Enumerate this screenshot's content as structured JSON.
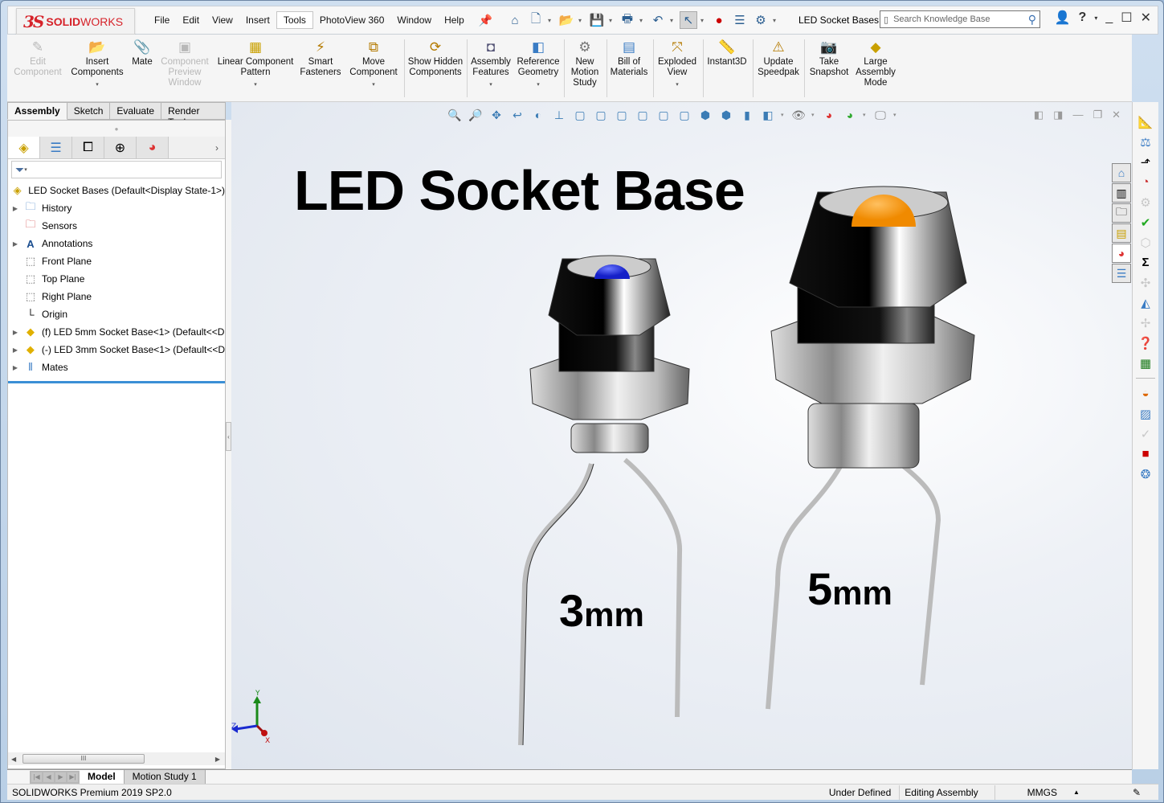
{
  "app": {
    "brand_prefix": "3S",
    "brand_bold": "SOLID",
    "brand_light": "WORKS",
    "document_title": "LED Socket Bases",
    "accent_color": "#d6232a"
  },
  "menu": [
    "File",
    "Edit",
    "View",
    "Insert",
    "Tools",
    "PhotoView 360",
    "Window",
    "Help"
  ],
  "menu_active": "Tools",
  "search": {
    "placeholder": "Search Knowledge Base"
  },
  "ribbon": [
    {
      "label": "Edit Component",
      "disabled": true,
      "icon": "edit-component-icon"
    },
    {
      "label": "Insert Components",
      "disabled": false,
      "dropdown": true,
      "icon": "insert-components-icon"
    },
    {
      "label": "Mate",
      "disabled": false,
      "icon": "mate-icon"
    },
    {
      "label": "Component Preview Window",
      "disabled": true,
      "icon": "preview-window-icon"
    },
    {
      "label": "Linear Component Pattern",
      "disabled": false,
      "dropdown": true,
      "icon": "linear-pattern-icon"
    },
    {
      "label": "Smart Fasteners",
      "disabled": false,
      "icon": "smart-fasteners-icon"
    },
    {
      "label": "Move Component",
      "disabled": false,
      "dropdown": true,
      "icon": "move-component-icon"
    },
    {
      "label": "Show Hidden Components",
      "disabled": false,
      "icon": "show-hidden-icon"
    },
    {
      "label": "Assembly Features",
      "disabled": false,
      "dropdown": true,
      "icon": "assembly-features-icon"
    },
    {
      "label": "Reference Geometry",
      "disabled": false,
      "dropdown": true,
      "icon": "reference-geometry-icon"
    },
    {
      "label": "New Motion Study",
      "disabled": false,
      "icon": "motion-study-icon"
    },
    {
      "label": "Bill of Materials",
      "disabled": false,
      "icon": "bom-icon"
    },
    {
      "label": "Exploded View",
      "disabled": false,
      "dropdown": true,
      "icon": "exploded-view-icon"
    },
    {
      "label": "Instant3D",
      "disabled": false,
      "icon": "instant3d-icon"
    },
    {
      "label": "Update Speedpak",
      "disabled": false,
      "icon": "speedpak-icon"
    },
    {
      "label": "Take Snapshot",
      "disabled": false,
      "icon": "snapshot-icon"
    },
    {
      "label": "Large Assembly Mode",
      "disabled": false,
      "icon": "large-assembly-icon"
    }
  ],
  "command_tabs": [
    "Assembly",
    "Sketch",
    "Evaluate",
    "Render Tools"
  ],
  "command_tab_active": "Assembly",
  "manager_tabs": [
    "FeatureManager",
    "PropertyManager",
    "ConfigurationManager",
    "DimXpertManager",
    "DisplayManager"
  ],
  "tree": {
    "root": "LED Socket Bases  (Default<Display State-1>)",
    "items": [
      {
        "label": "History",
        "expandable": true,
        "icon": "history-folder-icon"
      },
      {
        "label": "Sensors",
        "expandable": false,
        "icon": "sensors-folder-icon"
      },
      {
        "label": "Annotations",
        "expandable": true,
        "icon": "annotations-folder-icon"
      },
      {
        "label": "Front Plane",
        "expandable": false,
        "icon": "plane-icon"
      },
      {
        "label": "Top Plane",
        "expandable": false,
        "icon": "plane-icon"
      },
      {
        "label": "Right Plane",
        "expandable": false,
        "icon": "plane-icon"
      },
      {
        "label": "Origin",
        "expandable": false,
        "icon": "origin-icon"
      },
      {
        "label": "(f) LED 5mm Socket Base<1> (Default<<D",
        "expandable": true,
        "icon": "part-icon"
      },
      {
        "label": "(-) LED 3mm Socket Base<1> (Default<<D",
        "expandable": true,
        "icon": "part-icon"
      },
      {
        "label": "Mates",
        "expandable": true,
        "icon": "mates-icon"
      }
    ]
  },
  "viewport": {
    "title": "LED Socket Base",
    "label_small": {
      "num": "3",
      "unit": "mm"
    },
    "label_large": {
      "num": "5",
      "unit": "mm"
    },
    "led_small_color": "#1e2be0",
    "led_large_color": "#ff9a1a",
    "triad": {
      "x": "X",
      "y": "Y",
      "z": "Z"
    }
  },
  "bottom_tabs": [
    "Model",
    "Motion Study 1"
  ],
  "bottom_tab_active": "Model",
  "status": {
    "version": "SOLIDWORKS Premium 2019 SP2.0",
    "definition": "Under Defined",
    "mode": "Editing Assembly",
    "units": "MMGS"
  }
}
